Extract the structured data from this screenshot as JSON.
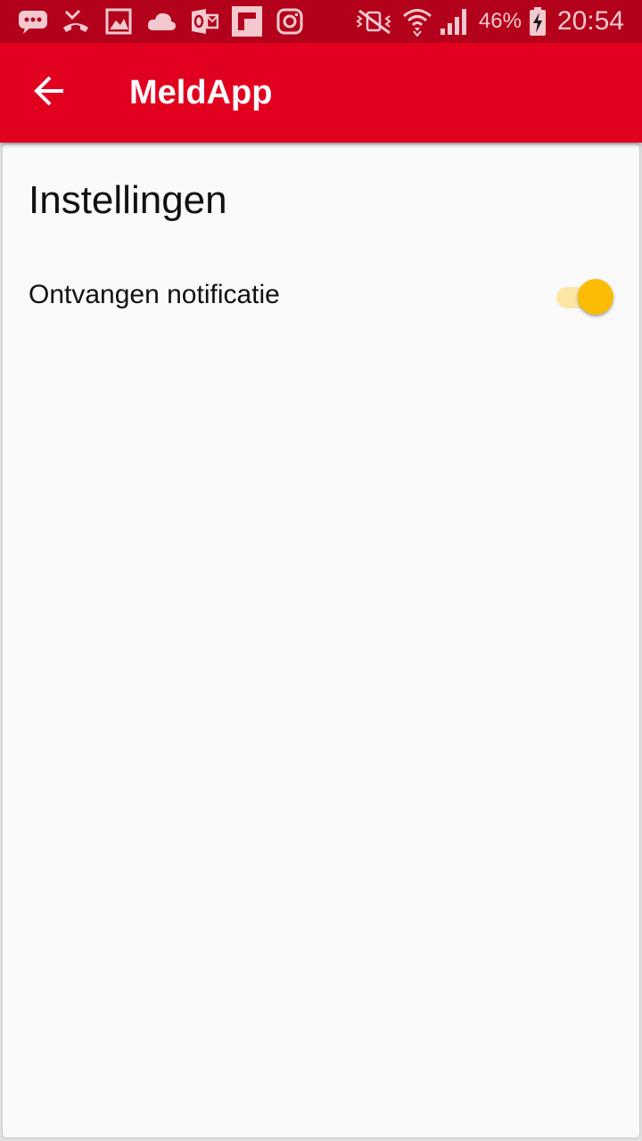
{
  "status_bar": {
    "left_icons": [
      "messages-icon",
      "missed-call-icon",
      "gallery-icon",
      "cloud-icon",
      "outlook-icon",
      "flipboard-icon",
      "instagram-icon"
    ],
    "right_icons": [
      "vibrate-mute-icon",
      "wifi-icon",
      "signal-icon"
    ],
    "battery": "46%",
    "time": "20:54",
    "background_color": "#b3001b"
  },
  "app_bar": {
    "title": "MeldApp",
    "back_icon": "arrow-back-icon",
    "background_color": "#e2001f"
  },
  "settings": {
    "title": "Instellingen",
    "items": [
      {
        "label": "Ontvangen notificatie",
        "enabled": true,
        "accent_color": "#fbbc05"
      }
    ]
  }
}
